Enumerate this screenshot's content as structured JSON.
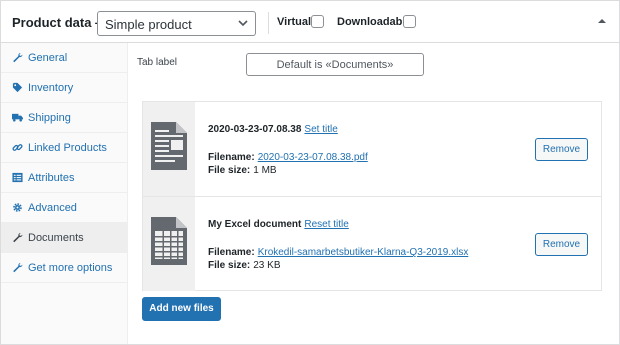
{
  "header": {
    "title": "Product data —",
    "product_type": "Simple product",
    "virtual_label": "Virtual:",
    "downloadable_label": "Downloadable:",
    "virtual_checked": false,
    "downloadable_checked": false
  },
  "sidebar": {
    "items": [
      {
        "label": "General",
        "icon": "wrench-icon",
        "active": false
      },
      {
        "label": "Inventory",
        "icon": "tag-icon",
        "active": false
      },
      {
        "label": "Shipping",
        "icon": "truck-icon",
        "active": false
      },
      {
        "label": "Linked Products",
        "icon": "link-icon",
        "active": false
      },
      {
        "label": "Attributes",
        "icon": "list-icon",
        "active": false
      },
      {
        "label": "Advanced",
        "icon": "gear-icon",
        "active": false
      },
      {
        "label": "Documents",
        "icon": "wrench-icon",
        "active": true
      },
      {
        "label": "Get more options",
        "icon": "wrench-icon",
        "active": false
      }
    ]
  },
  "main": {
    "tab_label_text": "Tab label",
    "tab_label_placeholder": "Default is «Documents»",
    "files": [
      {
        "title": "2020-03-23-07.08.38",
        "title_action": "Set title",
        "filename_label": "Filename:",
        "filename": "2020-03-23-07.08.38.pdf",
        "filesize_label": "File size:",
        "filesize": "1 MB",
        "icon": "document-icon",
        "remove_label": "Remove"
      },
      {
        "title": "My Excel document",
        "title_action": "Reset title",
        "filename_label": "Filename:",
        "filename": "Krokedil-samarbetsbutiker-Klarna-Q3-2019.xlsx",
        "filesize_label": "File size:",
        "filesize": "23 KB",
        "icon": "spreadsheet-icon",
        "remove_label": "Remove"
      }
    ],
    "add_files_label": "Add new files"
  },
  "colors": {
    "accent": "#2271b1",
    "border": "#dcdcde",
    "sidebar_bg": "#fafafa",
    "active_bg": "#eeeeee",
    "thumb_bg": "#f0f0f1",
    "icon_gray": "#646970"
  }
}
